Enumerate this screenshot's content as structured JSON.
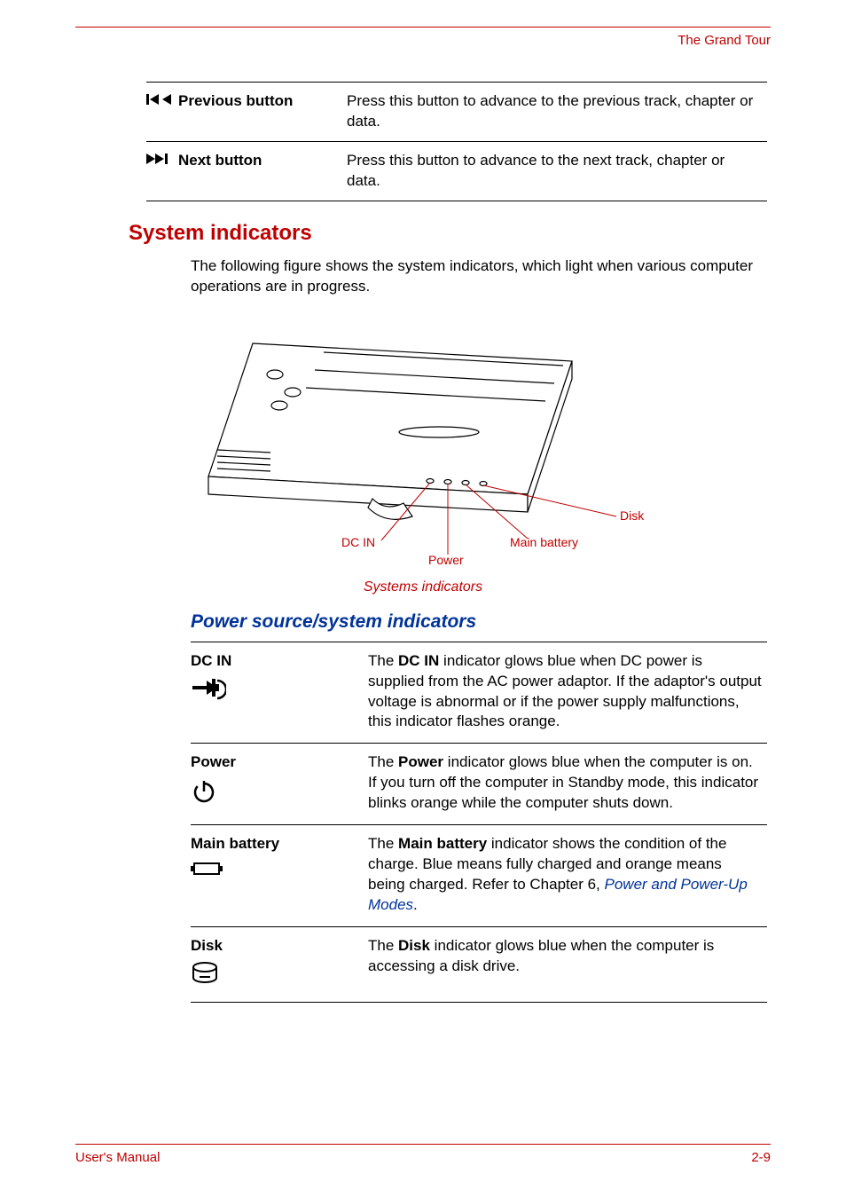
{
  "header": {
    "chapter_label": "The Grand Tour"
  },
  "buttons_table": {
    "rows": [
      {
        "label": "Previous button",
        "desc": "Press this button to advance to the previous track, chapter or data."
      },
      {
        "label": "Next button",
        "desc": "Press this button to advance to the next track, chapter or data."
      }
    ]
  },
  "section": {
    "title": "System indicators",
    "intro": "The following figure shows the system indicators, which light when various computer operations are in progress."
  },
  "figure": {
    "labels": {
      "dcin": "DC IN",
      "power": "Power",
      "main_battery": "Main battery",
      "disk": "Disk"
    },
    "caption": "Systems indicators"
  },
  "subsection": {
    "title": "Power source/system indicators"
  },
  "indicators": {
    "rows": [
      {
        "name": "DC IN",
        "desc_pre": "The ",
        "desc_bold": "DC IN",
        "desc_post": " indicator glows blue when DC power is supplied from  the AC power adaptor. If the adaptor's output voltage is abnormal or if the power supply malfunctions, this indicator flashes orange."
      },
      {
        "name": "Power",
        "desc_pre": "The ",
        "desc_bold": "Power",
        "desc_post": " indicator glows blue when the computer is on. If you turn off the computer in Standby mode, this indicator blinks orange while the computer shuts down."
      },
      {
        "name": "Main battery",
        "desc_pre": "The ",
        "desc_bold": "Main battery",
        "desc_post": " indicator shows the condition of the charge. Blue means fully charged and orange means being charged. Refer to Chapter 6, ",
        "link": "Power and Power-Up Modes",
        "post_link": "."
      },
      {
        "name": "Disk",
        "desc_pre": "The ",
        "desc_bold": "Disk",
        "desc_post": " indicator glows blue when the computer is accessing a disk drive."
      }
    ]
  },
  "footer": {
    "left": "User's Manual",
    "right": "2-9"
  }
}
